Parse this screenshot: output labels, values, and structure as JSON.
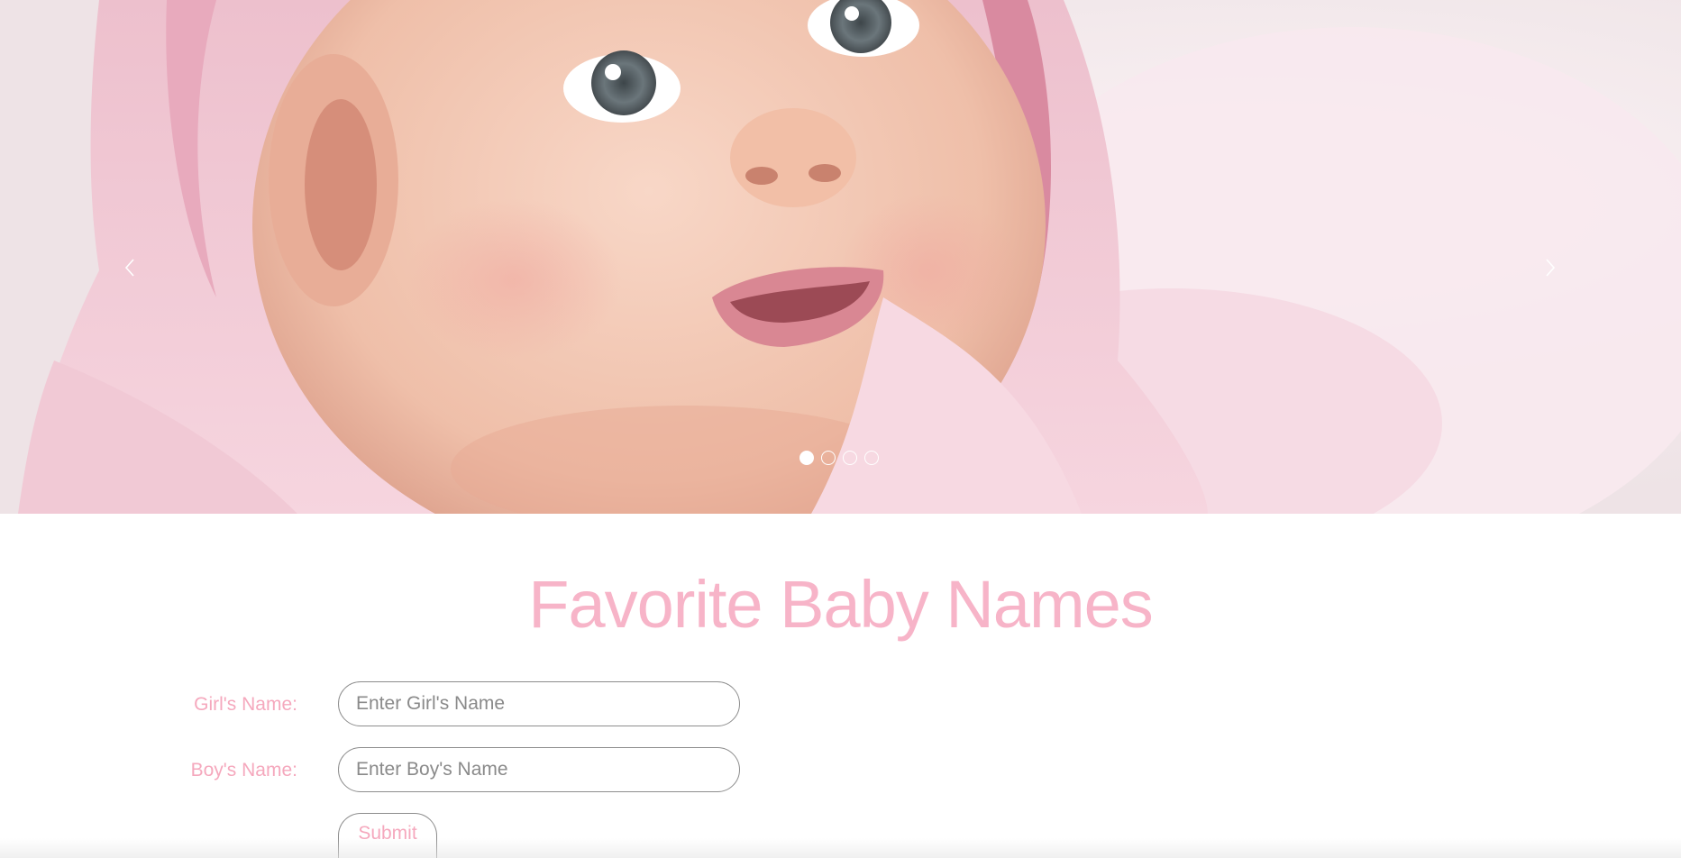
{
  "carousel": {
    "prev_icon": "chevron-left-icon",
    "next_icon": "chevron-right-icon",
    "slide_count": 4,
    "active_index": 0,
    "colors": {
      "hood": "#f2c6d3",
      "hood_inner": "#d9798f",
      "skin": "#f3c7b4",
      "eye": "#6a7479",
      "lips": "#d7808c"
    }
  },
  "page": {
    "title": "Favorite Baby Names",
    "accent_color": "#f7b4c8"
  },
  "form": {
    "girl_label": "Girl's Name:",
    "girl_placeholder": "Enter Girl's Name",
    "girl_value": "",
    "boy_label": "Boy's Name:",
    "boy_placeholder": "Enter Boy's Name",
    "boy_value": "",
    "submit_label": "Submit"
  }
}
